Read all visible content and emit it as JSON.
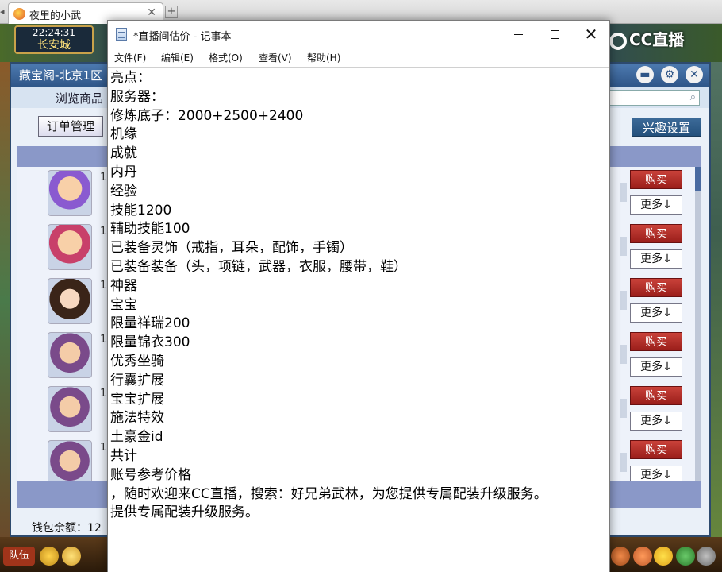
{
  "browser": {
    "tab_title": "夜里的小武",
    "tab_close": "✕",
    "new_tab": "+"
  },
  "game": {
    "clock_time": "22:24:31",
    "city": "长安城",
    "cc_logo": "CC直播",
    "team_button": "队伍"
  },
  "shop": {
    "title": "藏宝阁-北京1区",
    "browse": "浏览商品",
    "order_button": "订单管理",
    "interest_button": "兴趣设置",
    "buy_label": "购买",
    "more_label": "更多↓",
    "row_prefix": "1",
    "wallet_label": "钱包余额：12",
    "controls": [
      "▬",
      "⚙",
      "✕"
    ]
  },
  "notepad": {
    "title": "*直播间估价 - 记事本",
    "menu": [
      "文件(F)",
      "编辑(E)",
      "格式(O)",
      "查看(V)",
      "帮助(H)"
    ],
    "lines": [
      "亮点：",
      "服务器：",
      "修炼底子：2000+2500+2400",
      "机缘",
      "成就",
      "内丹",
      "经验",
      "技能1200",
      "辅助技能100",
      "已装备灵饰（戒指，耳朵，配饰，手镯）",
      "已装备装备（头，项链，武器，衣服，腰带，鞋）",
      "神器",
      "宝宝",
      "限量祥瑞200",
      "限量锦衣300",
      "优秀坐骑",
      "行囊扩展",
      "宝宝扩展",
      "施法特效",
      "土豪金id",
      "共计",
      "账号参考价格",
      "，随时欢迎来CC直播，搜索：好兄弟武林，为您提供专属配装升级服务。",
      "提供专属配装升级服务。"
    ]
  },
  "colors": {
    "buy_red": "#b02a24",
    "shop_blue": "#2e5587",
    "list_header": "#8a98c8"
  }
}
